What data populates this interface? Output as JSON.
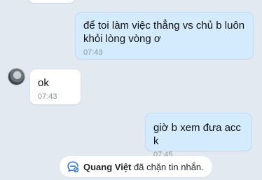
{
  "messages": [
    {
      "direction": "outgoing",
      "text": "để toi làm việc thẳng vs chủ b luôn\nkhỏi lòng vòng ơ",
      "time": "07:43"
    },
    {
      "direction": "incoming",
      "text": "ok",
      "time": "07:43"
    },
    {
      "direction": "outgoing",
      "text": "giờ b xem đưa acc k",
      "time": "07:45"
    }
  ],
  "notice": {
    "icon": "blocked-chat-icon",
    "name": "Quang Việt",
    "text": "đã chặn tin nhắn."
  },
  "colors": {
    "background": "#e2e9f1",
    "outgoing_bubble": "#d4ebfd",
    "incoming_bubble": "#ffffff",
    "accent": "#2a6fd6"
  }
}
